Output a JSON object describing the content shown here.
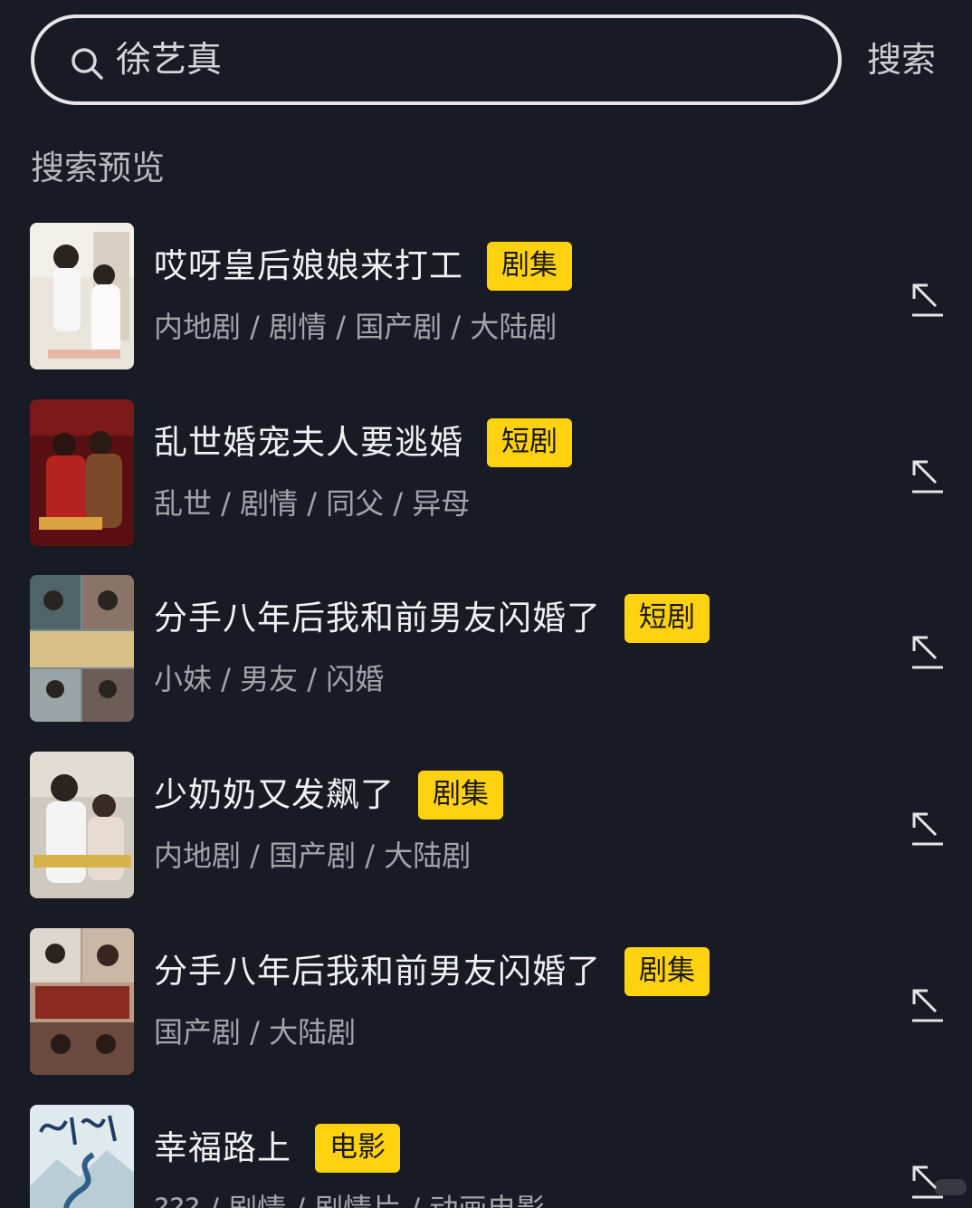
{
  "search": {
    "query": "徐艺真",
    "button_label": "搜索"
  },
  "section": {
    "title": "搜索预览"
  },
  "results": [
    {
      "title": "哎呀皇后娘娘来打工",
      "badge": "剧集",
      "tags": "内地剧 / 剧情 / 国产剧 / 大陆剧"
    },
    {
      "title": "乱世婚宠夫人要逃婚",
      "badge": "短剧",
      "tags": "乱世 / 剧情 / 同父 / 异母"
    },
    {
      "title": "分手八年后我和前男友闪婚了",
      "badge": "短剧",
      "tags": "小妹 / 男友 / 闪婚"
    },
    {
      "title": "少奶奶又发飙了",
      "badge": "剧集",
      "tags": "内地剧 / 国产剧 / 大陆剧"
    },
    {
      "title": "分手八年后我和前男友闪婚了",
      "badge": "剧集",
      "tags": "国产剧 / 大陆剧"
    },
    {
      "title": "幸福路上",
      "badge": "电影",
      "tags": "??? / 剧情 / 剧情片 / 动画电影"
    }
  ],
  "colors": {
    "background": "#181b24",
    "badge": "#ffd20f",
    "text_primary": "#f1f1f3",
    "text_secondary": "#a3a4aa"
  },
  "icons": {
    "search": "search-icon",
    "fill": "arrow-up-left-icon"
  }
}
